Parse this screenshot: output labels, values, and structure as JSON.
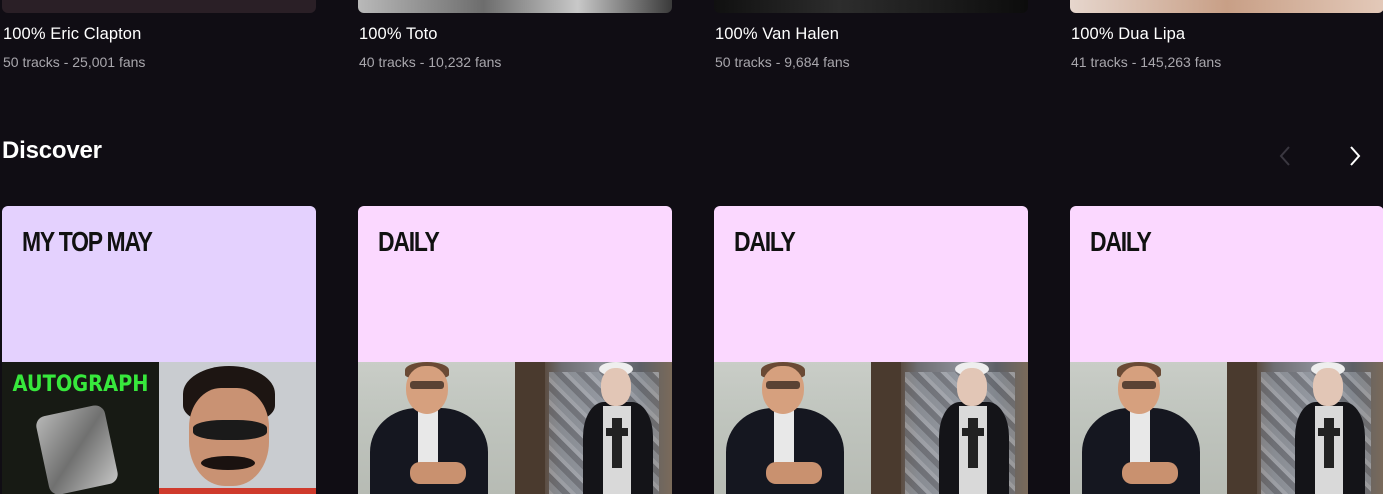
{
  "top_cards": [
    {
      "title": "100% Eric Clapton",
      "meta": "50 tracks - 25,001 fans",
      "thumb_color": "#2a1f26"
    },
    {
      "title": "100% Toto",
      "meta": "40 tracks - 10,232 fans",
      "thumb_color": "#8d8d8d"
    },
    {
      "title": "100% Van Halen",
      "meta": "50 tracks - 9,684 fans",
      "thumb_color": "#1a1a1a"
    },
    {
      "title": "100% Dua Lipa",
      "meta": "41 tracks - 145,263 fans",
      "thumb_color": "#d8c1b3"
    }
  ],
  "discover": {
    "title": "Discover",
    "prev_icon": "chevron-left-icon",
    "next_icon": "chevron-right-icon",
    "cards": [
      {
        "label": "MY TOP MAY",
        "bg": "#e4d1fe"
      },
      {
        "label": "DAILY",
        "bg": "#fbd8ff"
      },
      {
        "label": "DAILY",
        "bg": "#fbd8ff"
      },
      {
        "label": "DAILY",
        "bg": "#fbd8ff"
      }
    ],
    "autograph_text": "AUTOGRAPH"
  },
  "colors": {
    "background": "#100d14",
    "text_primary": "#ffffff",
    "text_secondary": "#a9a7ad",
    "accent_green": "#37e83c"
  }
}
